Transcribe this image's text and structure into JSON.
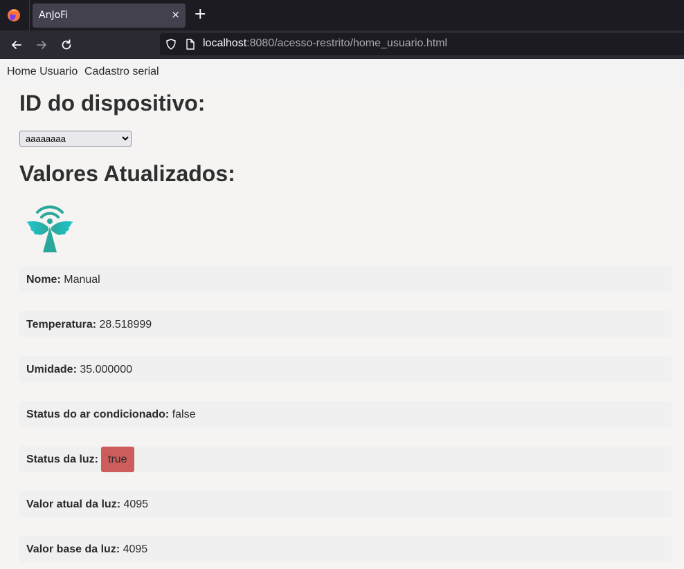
{
  "browser": {
    "tab_title": "AnJoFi",
    "tab_close": "×",
    "new_tab": "+",
    "url_host": "localhost",
    "url_rest": ":8080/acesso-restrito/home_usuario.html"
  },
  "nav": {
    "home": "Home Usuario",
    "cadastro": "Cadastro serial"
  },
  "device": {
    "title": "ID do dispositivo:",
    "selected": "aaaaaaaa"
  },
  "values": {
    "title": "Valores Atualizados:",
    "fields": [
      {
        "label": "Nome:",
        "value": "Manual"
      },
      {
        "label": "Temperatura:",
        "value": "28.518999"
      },
      {
        "label": "Umidade:",
        "value": "35.000000"
      },
      {
        "label": "Status do ar condicionado:",
        "value": "false"
      },
      {
        "label": "Status da luz:",
        "value": "true"
      },
      {
        "label": "Valor atual da luz:",
        "value": "4095"
      },
      {
        "label": "Valor base da luz:",
        "value": "4095"
      }
    ]
  },
  "colors": {
    "light_badge": "#cd5c5c",
    "logo_teal": "#2aa79b"
  }
}
